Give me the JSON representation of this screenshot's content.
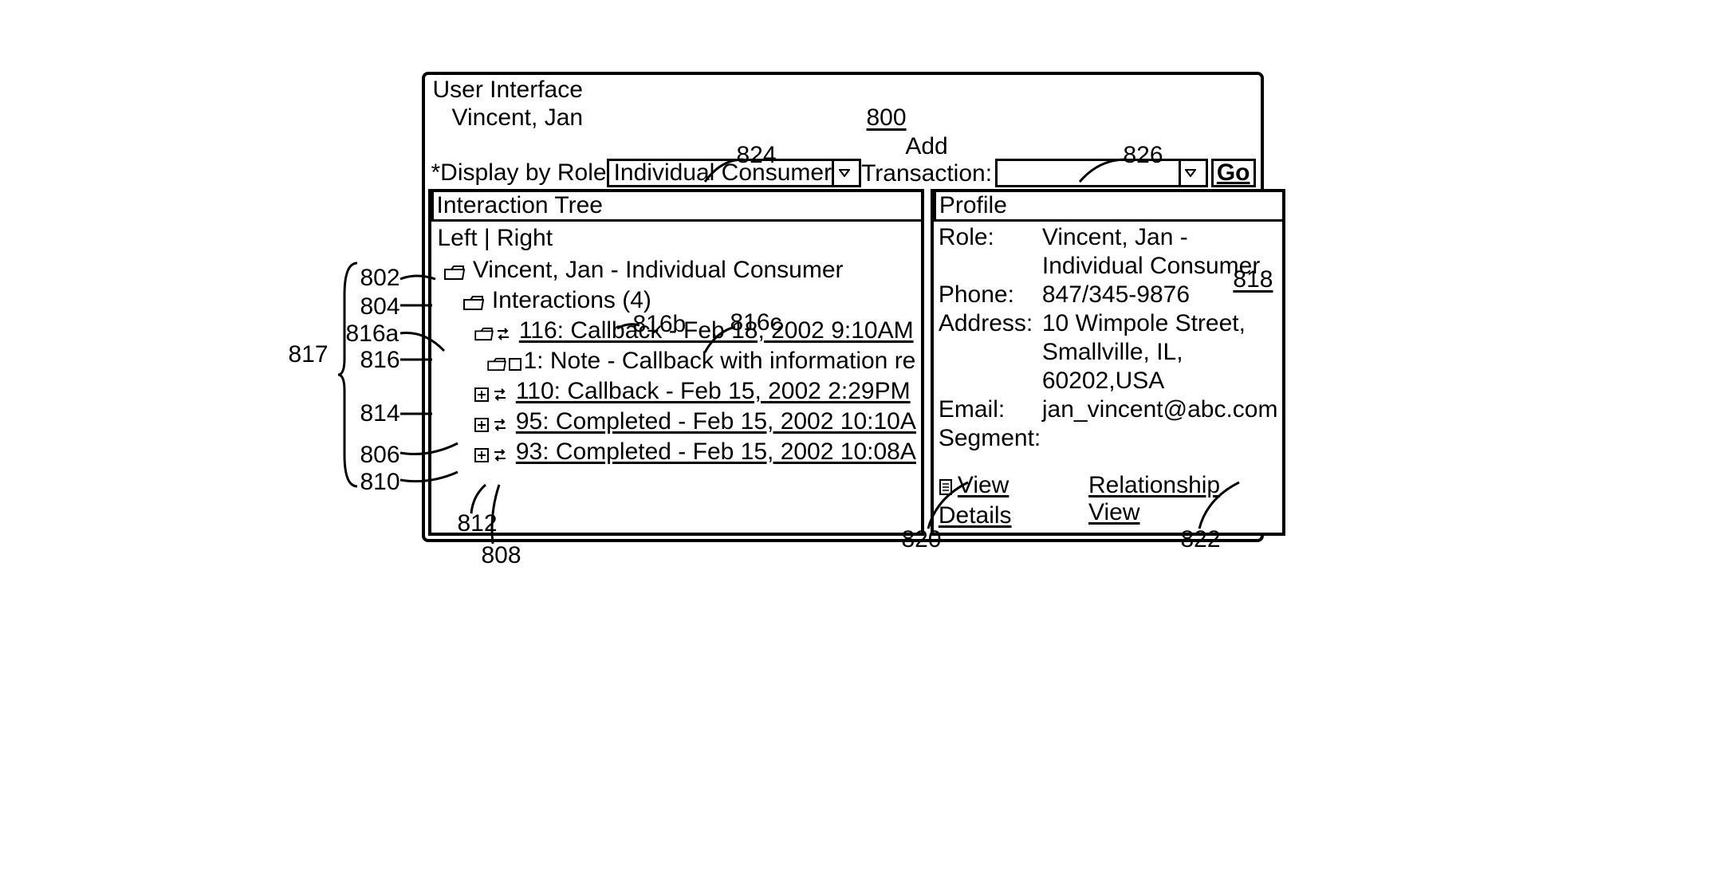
{
  "header": {
    "title": "User Interface",
    "subtitle": "Vincent, Jan"
  },
  "figure_numbers": {
    "main": "800",
    "profile": "818"
  },
  "controls": {
    "role_label": "*Display by Role",
    "role_value": "Individual Consumer",
    "add_label": "Add",
    "transaction_label": "Transaction:",
    "transaction_value": "",
    "go": "Go"
  },
  "left_panel": {
    "title": "Interaction Tree",
    "nav": "Left | Right",
    "tree": {
      "root": "Vincent, Jan - Individual Consumer",
      "interactions_label": "Interactions (4)",
      "items": [
        "116: Callback - Feb 18, 2002 9:10AM",
        "1: Note - Callback with information re",
        "110: Callback - Feb 15, 2002 2:29PM",
        "95: Completed - Feb 15, 2002 10:10A",
        "93: Completed - Feb 15, 2002 10:08A"
      ]
    }
  },
  "right_panel": {
    "title": "Profile",
    "role_label": "Role:",
    "role_value": "Vincent, Jan - Individual Consumer",
    "phone_label": "Phone:",
    "phone_value": "847/345-9876",
    "address_label": "Address:",
    "address_value_1": "10 Wimpole Street,",
    "address_value_2": "Smallville, IL, 60202,USA",
    "email_label": "Email:",
    "email_value": "jan_vincent@abc.com",
    "segment_label": "Segment:",
    "segment_value": "",
    "view_details": "View Details",
    "relationship_view": "Relationship View"
  },
  "callouts": {
    "c800": "800",
    "c824": "824",
    "c826": "826",
    "c817": "817",
    "c802": "802",
    "c804": "804",
    "c816a": "816a",
    "c816": "816",
    "c816b": "816b",
    "c816c": "816c",
    "c814": "814",
    "c806": "806",
    "c810": "810",
    "c812": "812",
    "c808": "808",
    "c818": "818",
    "c820": "820",
    "c822": "822"
  }
}
